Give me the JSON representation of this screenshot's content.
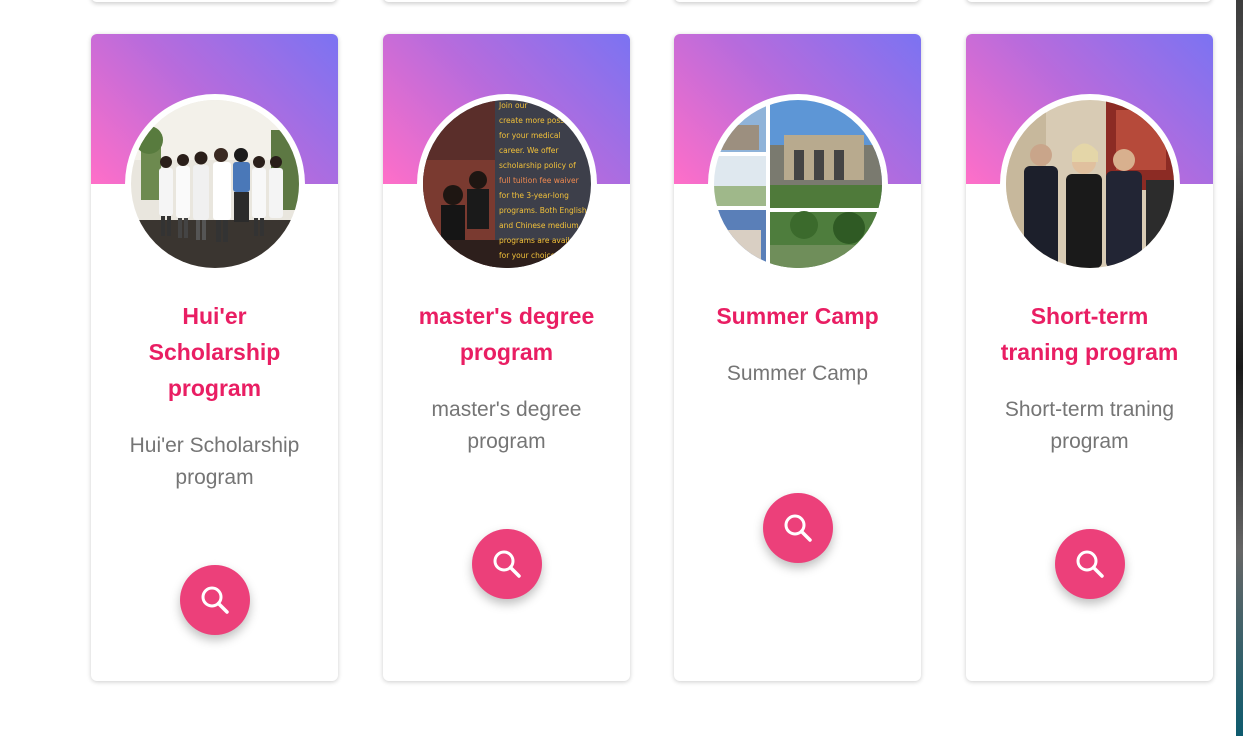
{
  "accent_color": "#e91e63",
  "button_color": "#ec407a",
  "cards": [
    {
      "title": "Hui'er Scholarship program",
      "description": "Hui'er Scholarship program",
      "image_icon": "group-photo-icon",
      "button_icon": "search-icon"
    },
    {
      "title": "master's degree program",
      "description": "master's degree program",
      "image_icon": "poster-photo-icon",
      "button_icon": "search-icon",
      "image_text": [
        "Join our",
        "create more poss",
        "for your medical",
        "career. We offer",
        "scholarship policy of",
        "full tuition fee waiver",
        "for the 3-year-long",
        "programs. Both English",
        "and Chinese medium",
        "programs are avail",
        "for your choice"
      ]
    },
    {
      "title": "Summer Camp",
      "description": "Summer Camp",
      "image_icon": "campus-collage-icon",
      "button_icon": "search-icon"
    },
    {
      "title": "Short-term traning program",
      "description": "Short-term traning program",
      "image_icon": "meeting-photo-icon",
      "button_icon": "search-icon"
    }
  ]
}
